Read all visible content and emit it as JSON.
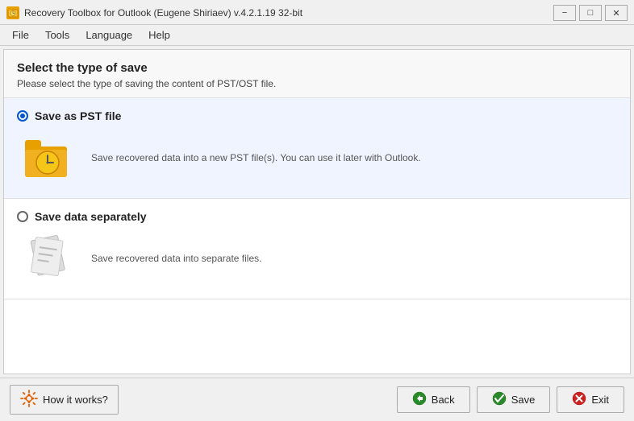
{
  "titlebar": {
    "title": "Recovery Toolbox for Outlook (Eugene Shiriaev) v.4.2.1.19 32-bit",
    "icon": "RT",
    "controls": {
      "minimize": "−",
      "maximize": "□",
      "close": "✕"
    }
  },
  "menu": {
    "items": [
      "File",
      "Tools",
      "Language",
      "Help"
    ]
  },
  "header": {
    "title": "Select the type of save",
    "subtitle": "Please select the type of saving the content of PST/OST file."
  },
  "options": [
    {
      "id": "pst",
      "label": "Save as PST file",
      "description": "Save recovered data into a new PST file(s). You can use it later with Outlook.",
      "selected": true
    },
    {
      "id": "separate",
      "label": "Save data separately",
      "description": "Save recovered data into separate files.",
      "selected": false
    }
  ],
  "footer": {
    "how_it_works": "How it works?",
    "back_label": "Back",
    "save_label": "Save",
    "exit_label": "Exit"
  }
}
